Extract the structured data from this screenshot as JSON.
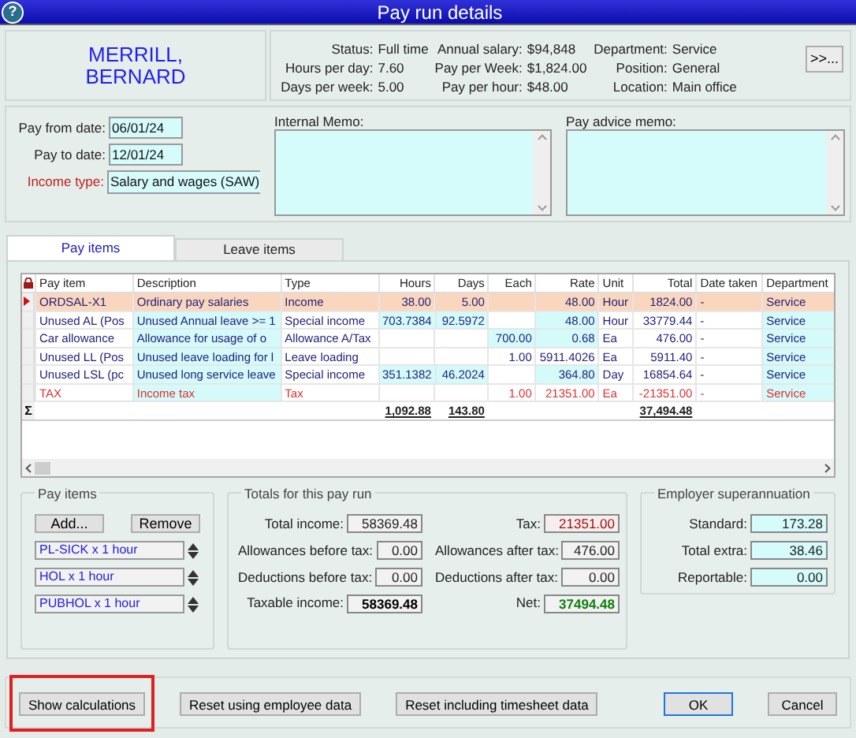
{
  "window": {
    "title": "Pay run details",
    "help_button": "?"
  },
  "employee": {
    "name": "MERRILL, BERNARD"
  },
  "info_columns": [
    [
      {
        "label": "Status:",
        "value": "Full time"
      },
      {
        "label": "Hours per day:",
        "value": "7.60"
      },
      {
        "label": "Days per week:",
        "value": "5.00"
      }
    ],
    [
      {
        "label": "Annual salary:",
        "value": "$94,848"
      },
      {
        "label": "Pay per Week:",
        "value": "$1,824.00"
      },
      {
        "label": "Pay per hour:",
        "value": "$48.00"
      }
    ],
    [
      {
        "label": "Department:",
        "value": "Service"
      },
      {
        "label": "Position:",
        "value": "General"
      },
      {
        "label": "Location:",
        "value": "Main office"
      }
    ]
  ],
  "more_button": ">>...",
  "form_fields": [
    {
      "label": "Pay from date:",
      "value": "06/01/24",
      "kind": "text",
      "required": false
    },
    {
      "label": "Pay to date:",
      "value": "12/01/24",
      "kind": "text",
      "required": false
    },
    {
      "label": "Income type:",
      "value": "Salary and wages (SAW)",
      "kind": "dropdown",
      "required": true
    }
  ],
  "memos": [
    {
      "label": "Internal Memo:"
    },
    {
      "label": "Pay advice memo:"
    }
  ],
  "tabs": [
    {
      "label": "Pay items",
      "selected": true
    },
    {
      "label": "Leave items",
      "selected": false
    }
  ],
  "table": {
    "columns": [
      "Pay item",
      "Description",
      "Type",
      "Hours",
      "Days",
      "Each",
      "Rate",
      "Unit",
      "Total",
      "Date taken",
      "Department"
    ],
    "rows": [
      {
        "kind": "current",
        "cells": [
          {
            "text": "ORDSAL-X1",
            "highlighted": false
          },
          {
            "text": "Ordinary pay salaries",
            "highlighted": false
          },
          {
            "text": "Income",
            "highlighted": false
          },
          {
            "text": "38.00",
            "highlighted": false
          },
          {
            "text": "5.00",
            "highlighted": false
          },
          {
            "highlighted": false
          },
          {
            "text": "48.00",
            "highlighted": false
          },
          {
            "text": "Hour",
            "highlighted": false
          },
          {
            "text": "1824.00",
            "highlighted": false
          },
          {
            "text": "-",
            "highlighted": false
          },
          {
            "text": "Service",
            "highlighted": false
          }
        ]
      },
      {
        "kind": "normal",
        "cells": [
          {
            "text": "Unused AL (Pos",
            "highlighted": false
          },
          {
            "text": "Unused Annual leave >= 1",
            "highlighted": true
          },
          {
            "text": "Special income",
            "highlighted": false
          },
          {
            "text": "703.7384",
            "highlighted": true
          },
          {
            "text": "92.5972",
            "highlighted": true
          },
          {
            "highlighted": false
          },
          {
            "text": "48.00",
            "highlighted": true
          },
          {
            "text": "Hour",
            "highlighted": false
          },
          {
            "text": "33779.44",
            "highlighted": false
          },
          {
            "text": "-",
            "highlighted": false
          },
          {
            "text": "Service",
            "highlighted": true
          }
        ]
      },
      {
        "kind": "normal",
        "cells": [
          {
            "text": "Car allowance",
            "highlighted": false
          },
          {
            "text": "Allowance for usage of o",
            "highlighted": true
          },
          {
            "text": "Allowance A/Tax",
            "highlighted": false
          },
          {
            "highlighted": false
          },
          {
            "highlighted": false
          },
          {
            "text": "700.00",
            "highlighted": true
          },
          {
            "text": "0.68",
            "highlighted": true
          },
          {
            "text": "Ea",
            "highlighted": false
          },
          {
            "text": "476.00",
            "highlighted": false
          },
          {
            "text": "-",
            "highlighted": false
          },
          {
            "text": "Service",
            "highlighted": true
          }
        ]
      },
      {
        "kind": "normal",
        "cells": [
          {
            "text": "Unused LL (Pos",
            "highlighted": false
          },
          {
            "text": "Unused leave loading for l",
            "highlighted": true
          },
          {
            "text": "Leave loading",
            "highlighted": false
          },
          {
            "highlighted": false
          },
          {
            "highlighted": false
          },
          {
            "text": "1.00",
            "highlighted": false
          },
          {
            "text": "5911.4026",
            "highlighted": false
          },
          {
            "text": "Ea",
            "highlighted": false
          },
          {
            "text": "5911.40",
            "highlighted": false
          },
          {
            "text": "-",
            "highlighted": false
          },
          {
            "text": "Service",
            "highlighted": true
          }
        ]
      },
      {
        "kind": "normal",
        "cells": [
          {
            "text": "Unused LSL (pc",
            "highlighted": false
          },
          {
            "text": "Unused long service leave",
            "highlighted": true
          },
          {
            "text": "Special income",
            "highlighted": false
          },
          {
            "text": "351.1382",
            "highlighted": true
          },
          {
            "text": "46.2024",
            "highlighted": true
          },
          {
            "highlighted": false
          },
          {
            "text": "364.80",
            "highlighted": true
          },
          {
            "text": "Day",
            "highlighted": false
          },
          {
            "text": "16854.64",
            "highlighted": false
          },
          {
            "text": "-",
            "highlighted": false
          },
          {
            "text": "Service",
            "highlighted": true
          }
        ]
      },
      {
        "kind": "tax",
        "cells": [
          {
            "text": "TAX",
            "highlighted": false
          },
          {
            "text": "Income tax",
            "highlighted": true
          },
          {
            "text": "Tax",
            "highlighted": false
          },
          {
            "highlighted": false
          },
          {
            "highlighted": false
          },
          {
            "text": "1.00",
            "highlighted": false
          },
          {
            "text": "21351.00",
            "highlighted": false
          },
          {
            "text": "Ea",
            "highlighted": false
          },
          {
            "text": "-21351.00",
            "highlighted": false
          },
          {
            "text": "-",
            "highlighted": false
          },
          {
            "text": "Service",
            "highlighted": true
          }
        ]
      }
    ],
    "sum_marker": "Σ",
    "sums": {
      "hours": "1,092.88",
      "days": "143.80",
      "total": "37,494.48"
    }
  },
  "pay_items": {
    "title": "Pay items",
    "add_button": "Add...",
    "remove_button": "Remove",
    "entries": [
      "PL-SICK x 1 hour",
      "HOL x 1 hour",
      "PUBHOL x 1 hour"
    ]
  },
  "totals": {
    "title": "Totals for this pay run",
    "columns": [
      [
        {
          "label": "Total income:",
          "value": "58369.48",
          "kind": "plain"
        },
        {
          "label": "Allowances before tax:",
          "value": "0.00",
          "kind": "plain"
        },
        {
          "label": "Deductions before tax:",
          "value": "0.00",
          "kind": "plain"
        },
        {
          "label": "Taxable income:",
          "value": "58369.48",
          "kind": "bold"
        }
      ],
      [
        {
          "label": "Tax:",
          "value": "21351.00",
          "kind": "negative"
        },
        {
          "label": "Allowances after tax:",
          "value": "476.00",
          "kind": "plain"
        },
        {
          "label": "Deductions after tax:",
          "value": "0.00",
          "kind": "plain"
        },
        {
          "label": "Net:",
          "value": "37494.48",
          "kind": "net"
        }
      ]
    ]
  },
  "superannuation": {
    "title": "Employer superannuation",
    "fields": [
      {
        "label": "Standard:",
        "value": "173.28"
      },
      {
        "label": "Total extra:",
        "value": "38.46"
      },
      {
        "label": "Reportable:",
        "value": "0.00"
      }
    ]
  },
  "buttons": [
    {
      "label": "Show calculations",
      "highlighted": true,
      "default": false
    },
    {
      "label": "Reset using employee data",
      "highlighted": false,
      "default": false
    },
    {
      "label": "Reset including timesheet data",
      "highlighted": false,
      "default": false
    },
    {
      "label": "OK",
      "highlighted": false,
      "default": true
    },
    {
      "label": "Cancel",
      "highlighted": false,
      "default": false
    }
  ]
}
